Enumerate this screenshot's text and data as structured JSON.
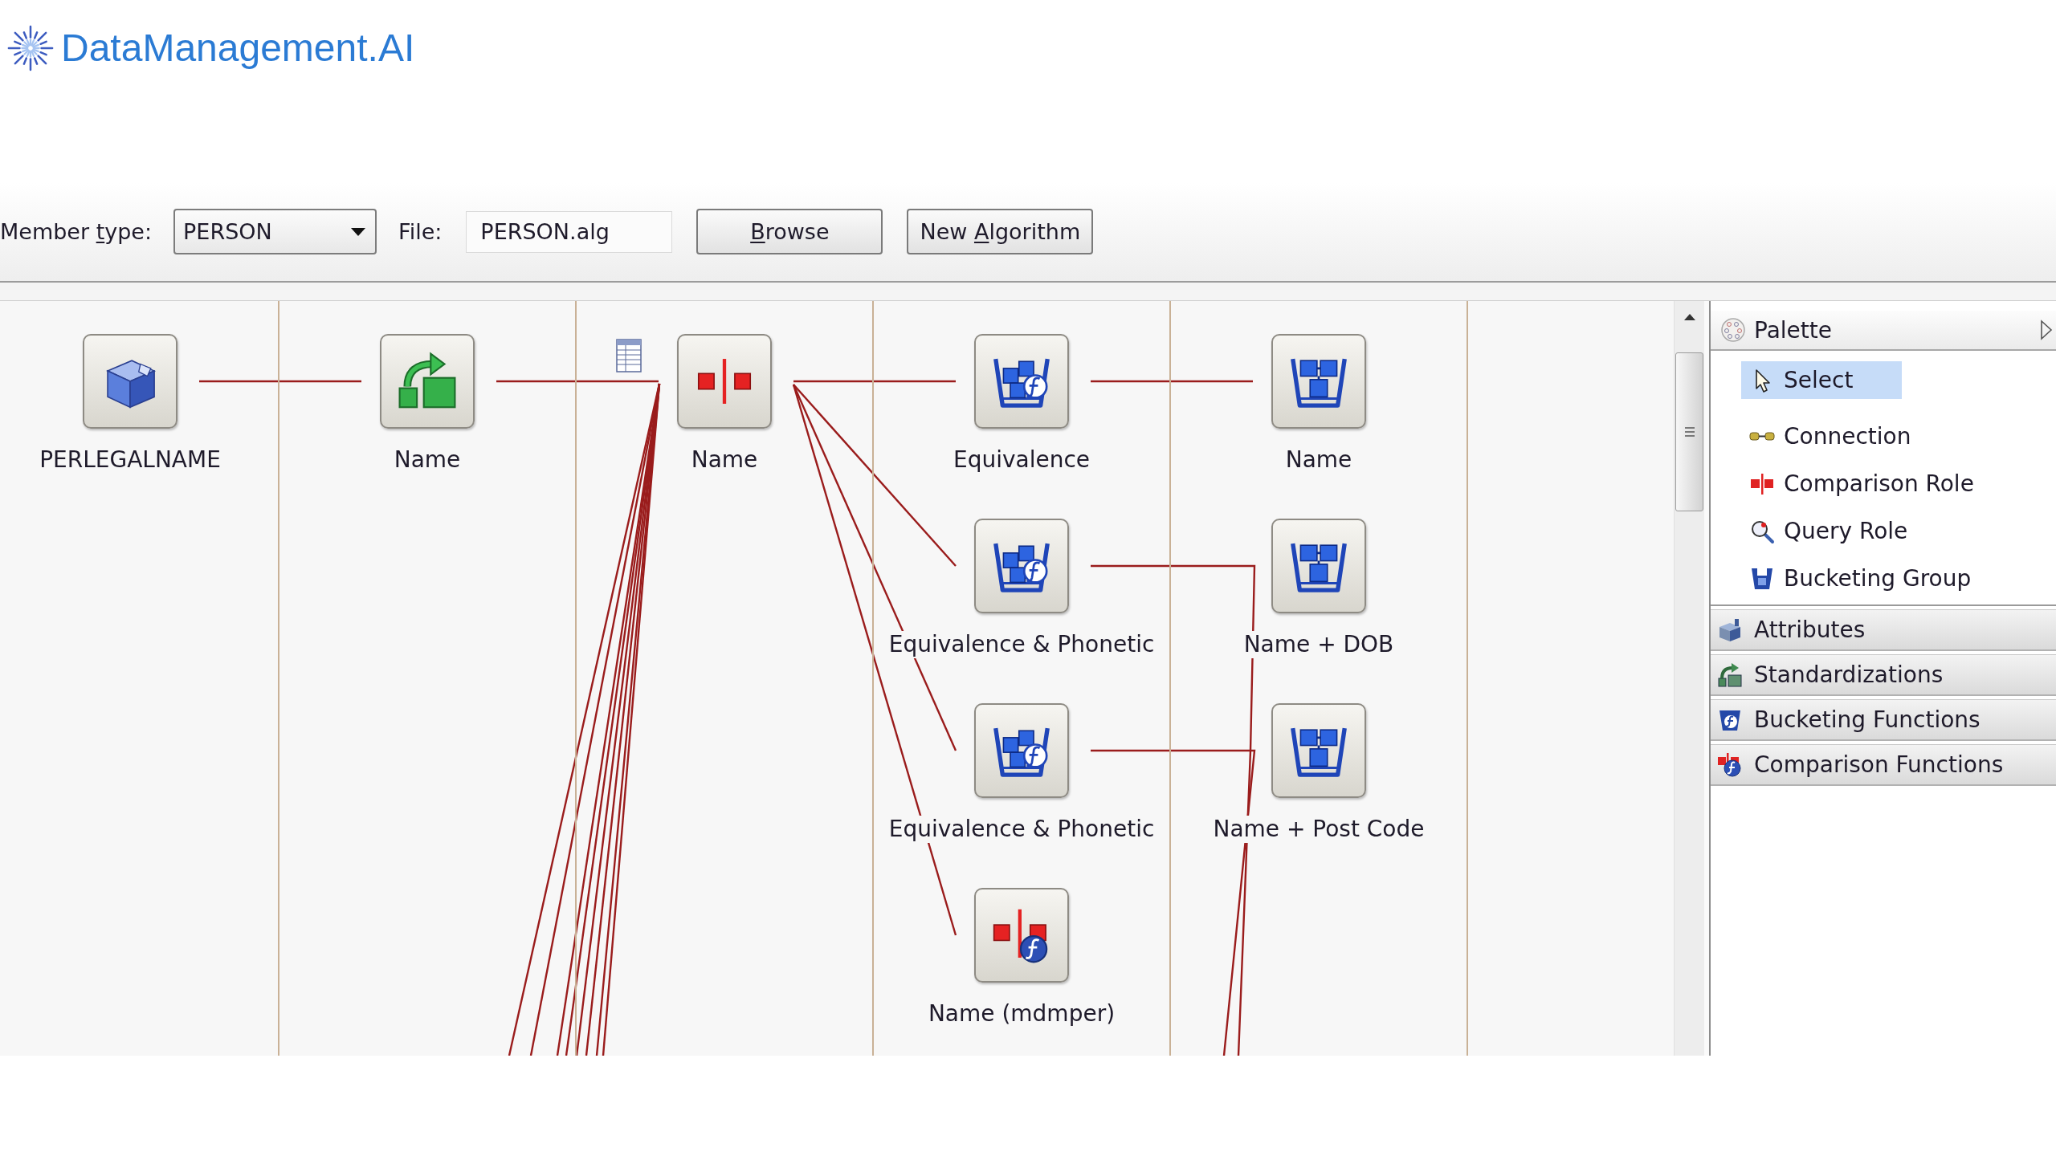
{
  "logo": {
    "text": "DataManagement.AI"
  },
  "toolbar": {
    "member_type": {
      "label": {
        "before": "Member ",
        "mnemonic": "t",
        "after": "ype:"
      },
      "value": "PERSON"
    },
    "file": {
      "label": "File:",
      "value": "PERSON.alg"
    },
    "buttons": [
      {
        "mnemonic": "B",
        "after": "rowse"
      },
      {
        "before": "New ",
        "mnemonic": "A",
        "after": "lgorithm"
      }
    ]
  },
  "canvas": {
    "columns": [
      {
        "nodes": [
          {
            "kind": "attribute",
            "label": "PERLEGALNAME"
          }
        ]
      },
      {
        "nodes": [
          {
            "kind": "standardization",
            "label": "Name"
          }
        ]
      },
      {
        "nodes": [
          {
            "kind": "comparison_role",
            "label": "Name",
            "table_marker": true
          }
        ]
      },
      {
        "nodes": [
          {
            "kind": "bucketing_function",
            "label": "Equivalence"
          },
          {
            "kind": "bucketing_function",
            "label": "Equivalence & Phonetic"
          },
          {
            "kind": "bucketing_function",
            "label": "Equivalence & Phonetic"
          },
          {
            "kind": "comparison_function",
            "label": "Name (mdmper)"
          }
        ]
      },
      {
        "nodes": [
          {
            "kind": "bucketing_group",
            "label": "Name"
          },
          {
            "kind": "bucketing_group",
            "label": "Name + DOB"
          },
          {
            "kind": "bucketing_group",
            "label": "Name + Post Code"
          }
        ]
      }
    ]
  },
  "palette": {
    "title": "Palette",
    "tools": [
      {
        "kind": "select",
        "label": "Select",
        "selected": true
      },
      {
        "kind": "connection",
        "label": "Connection",
        "selected": false
      },
      {
        "kind": "comparison_role",
        "label": "Comparison Role",
        "selected": false
      },
      {
        "kind": "query_role",
        "label": "Query Role",
        "selected": false
      },
      {
        "kind": "bucketing_group",
        "label": "Bucketing Group",
        "selected": false
      }
    ],
    "drawers": [
      {
        "kind": "attributes",
        "label": "Attributes",
        "expanded": false
      },
      {
        "kind": "standardizations",
        "label": "Standardizations",
        "expanded": false
      },
      {
        "kind": "bucketing_functions",
        "label": "Bucketing Functions",
        "expanded": false
      },
      {
        "kind": "comparison_functions",
        "label": "Comparison Functions",
        "expanded": false
      }
    ]
  }
}
